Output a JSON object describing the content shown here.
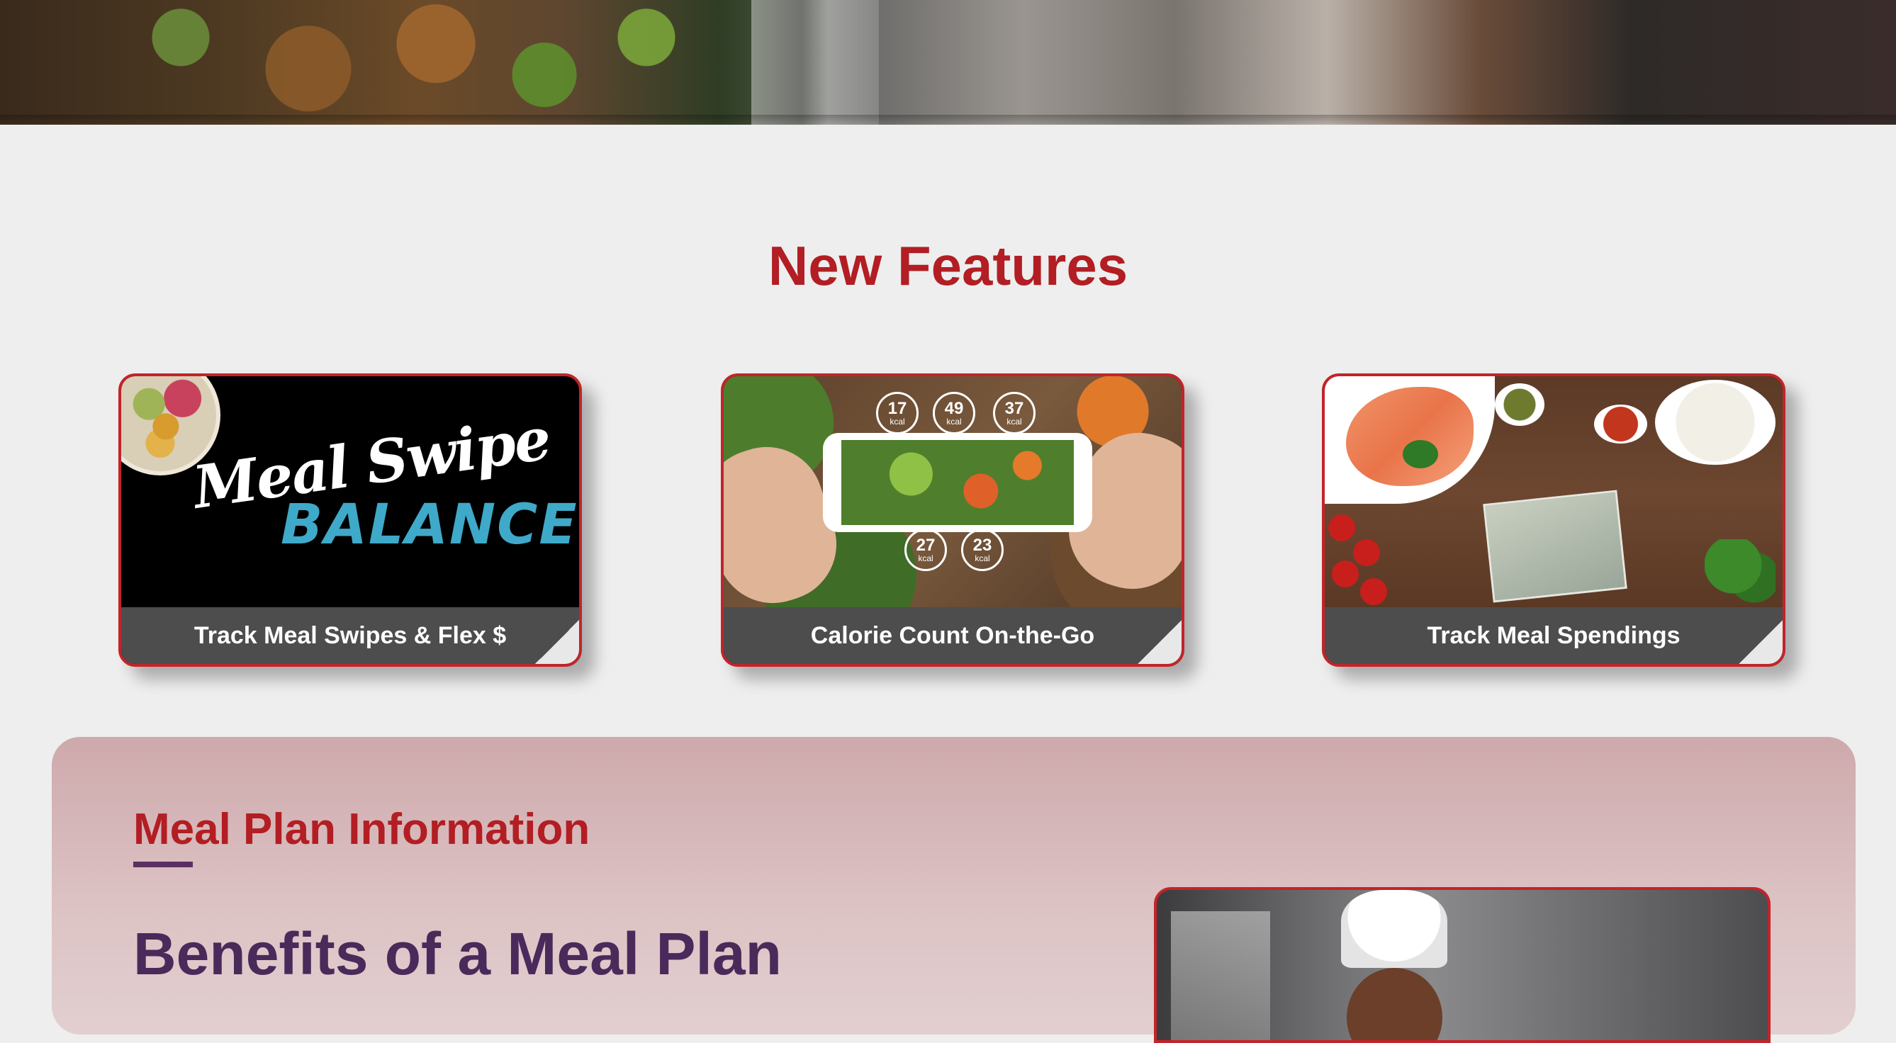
{
  "section_title": "New Features",
  "features": [
    {
      "caption": "Track Meal Swipes & Flex $",
      "art_script": "Meal Swipe",
      "art_word": "BALANCE",
      "icon": "meal-swipe-balance-image"
    },
    {
      "caption": "Calorie Count On-the-Go",
      "kcal_values": [
        "17",
        "49",
        "37",
        "27",
        "23"
      ],
      "kcal_unit": "kcal",
      "icon": "phone-vegetables-image"
    },
    {
      "caption": "Track Meal Spendings",
      "icon": "salmon-cash-image"
    }
  ],
  "meal_plan": {
    "heading": "Meal Plan Information",
    "subheading": "Benefits of a Meal Plan",
    "image": "chef-image"
  },
  "colors": {
    "accent_red": "#b21e23",
    "caption_bg": "#4d4d4d",
    "purple": "#4a2a5a"
  }
}
